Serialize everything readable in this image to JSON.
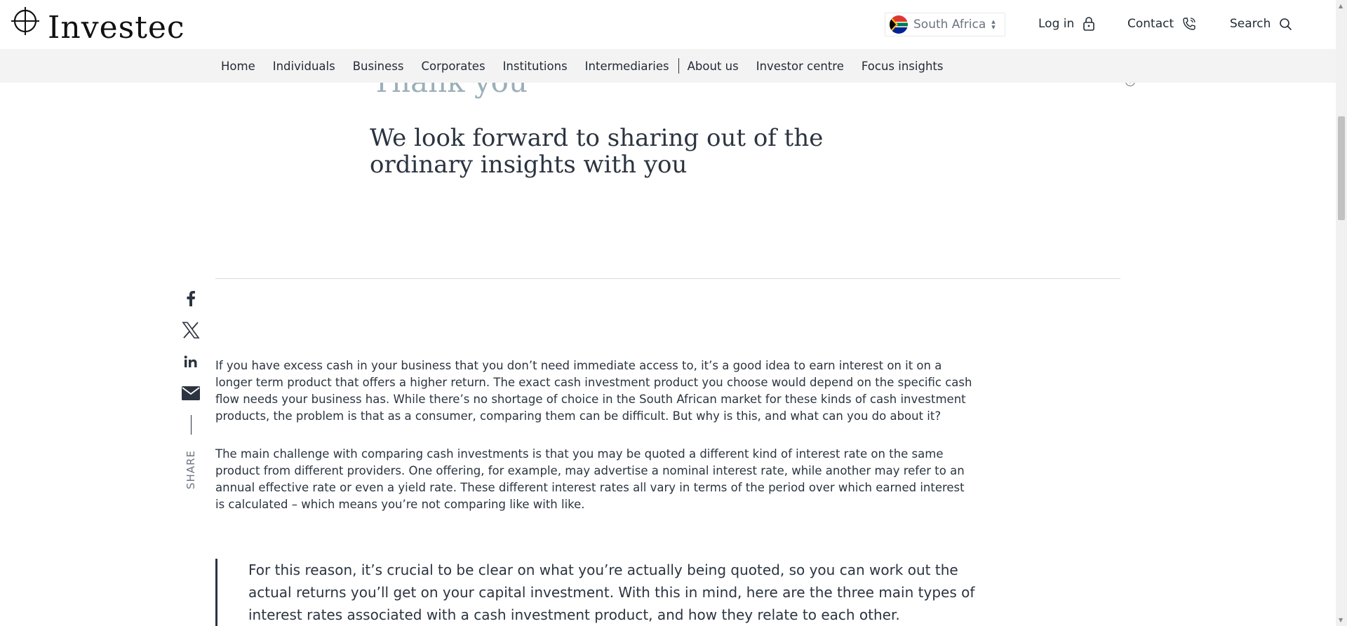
{
  "header": {
    "logo_text": "Investec",
    "country": "South Africa",
    "login_label": "Log in",
    "contact_label": "Contact",
    "search_label": "Search"
  },
  "nav": {
    "items": [
      "Home",
      "Individuals",
      "Business",
      "Corporates",
      "Institutions",
      "Intermediaries",
      "About us",
      "Investor centre",
      "Focus insights"
    ]
  },
  "content": {
    "thanks_title": "Thank you",
    "thanks_subtitle": "We look forward to sharing out of the ordinary insights with you",
    "share_label": "SHARE",
    "paragraph1": "If you have excess cash in your business that you don’t need immediate access to, it’s a good idea to earn interest on it on a longer term product that offers a higher return. The exact cash investment product you choose would depend on the specific cash flow needs your business has. While there’s no shortage of choice in the South African market for these kinds of cash investment products, the problem is that as a consumer, comparing them can be difficult. But why is this, and what can you do about it?",
    "paragraph2": "The main challenge with comparing cash investments is that you may be quoted a different kind of interest rate on the same product from different providers. One offering, for example, may advertise a nominal interest rate, while another may refer to an annual effective rate or even a yield rate. These different interest rates all vary in terms of the period over which earned interest is calculated – which means you’re not comparing like with like.",
    "quote": "For this reason, it’s crucial to be clear on what you’re actually being quoted, so you can work out the actual returns you’ll get on your capital investment. With this in mind, here are the three main types of interest rates associated with a cash investment product, and how they relate to each other."
  },
  "icons": {
    "share": [
      "facebook-icon",
      "x-icon",
      "linkedin-icon",
      "email-icon"
    ],
    "header": [
      "lock-icon",
      "phone-icon",
      "search-icon"
    ]
  }
}
